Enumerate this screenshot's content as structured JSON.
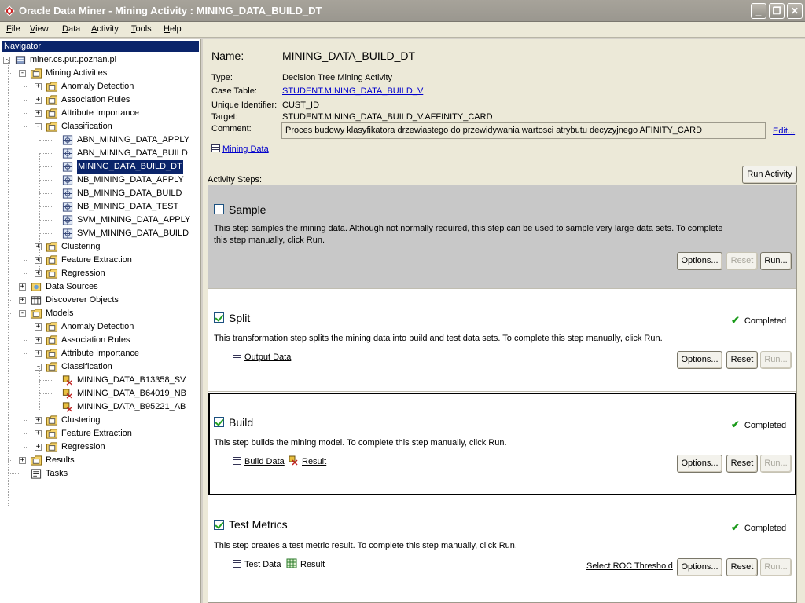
{
  "window": {
    "title": "Oracle Data Miner - Mining Activity : MINING_DATA_BUILD_DT"
  },
  "menu": [
    {
      "label": "File",
      "key": "F",
      "rest": "ile"
    },
    {
      "label": "View",
      "key": "V",
      "rest": "iew"
    },
    {
      "label": "Data",
      "key": "D",
      "rest": "ata"
    },
    {
      "label": "Activity",
      "key": "A",
      "rest": "ctivity"
    },
    {
      "label": "Tools",
      "key": "T",
      "rest": "ools"
    },
    {
      "label": "Help",
      "key": "H",
      "rest": "elp"
    }
  ],
  "navigator": {
    "title": "Navigator",
    "items": [
      {
        "label": "miner.cs.put.poznan.pl",
        "icon": "server-icon"
      },
      {
        "label": "Mining Activities",
        "icon": "folder-icon"
      },
      {
        "label": "Anomaly Detection",
        "icon": "folder-icon"
      },
      {
        "label": "Association Rules",
        "icon": "folder-icon"
      },
      {
        "label": "Attribute Importance",
        "icon": "folder-icon"
      },
      {
        "label": "Classification",
        "icon": "folder-icon"
      },
      {
        "label": "ABN_MINING_DATA_APPLY",
        "icon": "activity-icon"
      },
      {
        "label": "ABN_MINING_DATA_BUILD",
        "icon": "activity-icon"
      },
      {
        "label": "MINING_DATA_BUILD_DT",
        "icon": "activity-icon"
      },
      {
        "label": "NB_MINING_DATA_APPLY",
        "icon": "activity-icon"
      },
      {
        "label": "NB_MINING_DATA_BUILD",
        "icon": "activity-icon"
      },
      {
        "label": "NB_MINING_DATA_TEST",
        "icon": "activity-icon"
      },
      {
        "label": "SVM_MINING_DATA_APPLY",
        "icon": "activity-icon"
      },
      {
        "label": "SVM_MINING_DATA_BUILD",
        "icon": "activity-icon"
      },
      {
        "label": "Clustering",
        "icon": "folder-icon"
      },
      {
        "label": "Feature Extraction",
        "icon": "folder-icon"
      },
      {
        "label": "Regression",
        "icon": "folder-icon"
      },
      {
        "label": "Data Sources",
        "icon": "database-icon"
      },
      {
        "label": "Discoverer Objects",
        "icon": "table-icon"
      },
      {
        "label": "Models",
        "icon": "folder-icon"
      },
      {
        "label": "Anomaly Detection",
        "icon": "folder-icon"
      },
      {
        "label": "Association Rules",
        "icon": "folder-icon"
      },
      {
        "label": "Attribute Importance",
        "icon": "folder-icon"
      },
      {
        "label": "Classification",
        "icon": "folder-icon"
      },
      {
        "label": "MINING_DATA_B13358_SV",
        "icon": "model-icon"
      },
      {
        "label": "MINING_DATA_B64019_NB",
        "icon": "model-icon"
      },
      {
        "label": "MINING_DATA_B95221_AB",
        "icon": "model-icon"
      },
      {
        "label": "Clustering",
        "icon": "folder-icon"
      },
      {
        "label": "Feature Extraction",
        "icon": "folder-icon"
      },
      {
        "label": "Regression",
        "icon": "folder-icon"
      },
      {
        "label": "Results",
        "icon": "folder-icon"
      },
      {
        "label": "Tasks",
        "icon": "tasks-icon"
      }
    ]
  },
  "activity": {
    "name_label": "Name:",
    "name": "MINING_DATA_BUILD_DT",
    "type_label": "Type:",
    "type": "Decision Tree Mining Activity",
    "case_table_label": "Case Table:",
    "case_table": "STUDENT.MINING_DATA_BUILD_V",
    "uid_label": "Unique Identifier:",
    "uid": "CUST_ID",
    "target_label": "Target:",
    "target": "STUDENT.MINING_DATA_BUILD_V.AFFINITY_CARD",
    "comment_label": "Comment:",
    "comment": "Proces budowy klasyfikatora drzewiastego do przewidywania wartosci atrybutu decyzyjnego AFINITY_CARD",
    "edit_link": "Edit...",
    "mining_data_link": "Mining Data",
    "run_activity": "Run Activity",
    "steps_label": "Activity Steps:"
  },
  "steps": {
    "sample": {
      "title": "Sample",
      "checked": false,
      "desc": "This step samples the mining data. Although not normally required, this step can be used to sample very large data sets. To complete this step manually, click Run.",
      "options": "Options...",
      "reset": "Reset",
      "run": "Run..."
    },
    "split": {
      "title": "Split",
      "checked": true,
      "status": "Completed",
      "desc": "This transformation step splits the mining data into build and test data sets. To complete this step manually, click Run.",
      "link1": "Output Data",
      "options": "Options...",
      "reset": "Reset",
      "run": "Run..."
    },
    "build": {
      "title": "Build",
      "checked": true,
      "status": "Completed",
      "desc": "This step builds the mining model. To complete this step manually, click Run.",
      "link1": "Build Data",
      "link2": "Result",
      "options": "Options...",
      "reset": "Reset",
      "run": "Run..."
    },
    "test": {
      "title": "Test Metrics",
      "checked": true,
      "status": "Completed",
      "desc": "This step creates a test metric result. To complete this step manually, click Run.",
      "link1": "Test Data",
      "link2": "Result",
      "roc_link": "Select ROC Threshold",
      "options": "Options...",
      "reset": "Reset",
      "run": "Run..."
    }
  },
  "colors": {
    "selection": "#0a246a",
    "link": "#0000cc",
    "completed": "#1a9a1a"
  }
}
